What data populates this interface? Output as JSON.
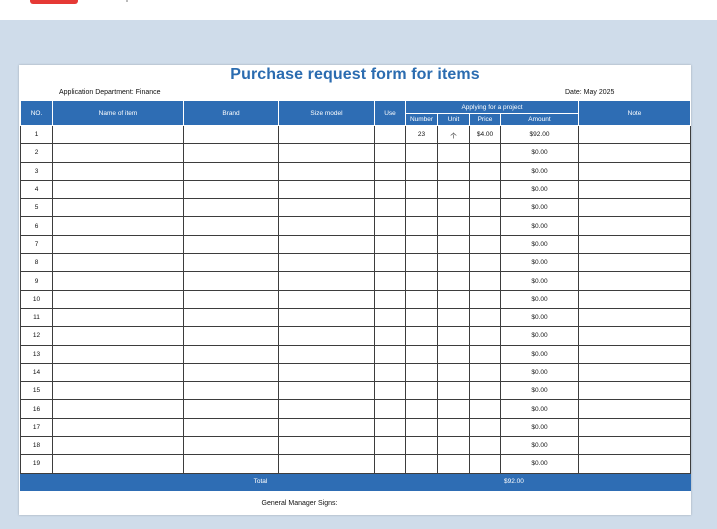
{
  "document": {
    "title": "Purchase request form for items",
    "department": "Application Department: Finance",
    "date": "Date: May 2025",
    "signature_label": "General Manager Signs:"
  },
  "table": {
    "headers": {
      "no": "NO.",
      "name": "Name of item",
      "brand": "Brand",
      "size": "Size model",
      "use": "Use",
      "group": "Applying for a project",
      "number": "Number",
      "unit": "Unit",
      "price": "Price",
      "amount": "Amount",
      "note": "Note"
    },
    "rows": [
      {
        "no": "1",
        "name": "",
        "brand": "",
        "size": "",
        "use": "",
        "number": "23",
        "unit": "个",
        "price": "$4.00",
        "amount": "$92.00",
        "note": ""
      },
      {
        "no": "2",
        "name": "",
        "brand": "",
        "size": "",
        "use": "",
        "number": "",
        "unit": "",
        "price": "",
        "amount": "$0.00",
        "note": ""
      },
      {
        "no": "3",
        "name": "",
        "brand": "",
        "size": "",
        "use": "",
        "number": "",
        "unit": "",
        "price": "",
        "amount": "$0.00",
        "note": ""
      },
      {
        "no": "4",
        "name": "",
        "brand": "",
        "size": "",
        "use": "",
        "number": "",
        "unit": "",
        "price": "",
        "amount": "$0.00",
        "note": ""
      },
      {
        "no": "5",
        "name": "",
        "brand": "",
        "size": "",
        "use": "",
        "number": "",
        "unit": "",
        "price": "",
        "amount": "$0.00",
        "note": ""
      },
      {
        "no": "6",
        "name": "",
        "brand": "",
        "size": "",
        "use": "",
        "number": "",
        "unit": "",
        "price": "",
        "amount": "$0.00",
        "note": ""
      },
      {
        "no": "7",
        "name": "",
        "brand": "",
        "size": "",
        "use": "",
        "number": "",
        "unit": "",
        "price": "",
        "amount": "$0.00",
        "note": ""
      },
      {
        "no": "8",
        "name": "",
        "brand": "",
        "size": "",
        "use": "",
        "number": "",
        "unit": "",
        "price": "",
        "amount": "$0.00",
        "note": ""
      },
      {
        "no": "9",
        "name": "",
        "brand": "",
        "size": "",
        "use": "",
        "number": "",
        "unit": "",
        "price": "",
        "amount": "$0.00",
        "note": ""
      },
      {
        "no": "10",
        "name": "",
        "brand": "",
        "size": "",
        "use": "",
        "number": "",
        "unit": "",
        "price": "",
        "amount": "$0.00",
        "note": ""
      },
      {
        "no": "11",
        "name": "",
        "brand": "",
        "size": "",
        "use": "",
        "number": "",
        "unit": "",
        "price": "",
        "amount": "$0.00",
        "note": ""
      },
      {
        "no": "12",
        "name": "",
        "brand": "",
        "size": "",
        "use": "",
        "number": "",
        "unit": "",
        "price": "",
        "amount": "$0.00",
        "note": ""
      },
      {
        "no": "13",
        "name": "",
        "brand": "",
        "size": "",
        "use": "",
        "number": "",
        "unit": "",
        "price": "",
        "amount": "$0.00",
        "note": ""
      },
      {
        "no": "14",
        "name": "",
        "brand": "",
        "size": "",
        "use": "",
        "number": "",
        "unit": "",
        "price": "",
        "amount": "$0.00",
        "note": ""
      },
      {
        "no": "15",
        "name": "",
        "brand": "",
        "size": "",
        "use": "",
        "number": "",
        "unit": "",
        "price": "",
        "amount": "$0.00",
        "note": ""
      },
      {
        "no": "16",
        "name": "",
        "brand": "",
        "size": "",
        "use": "",
        "number": "",
        "unit": "",
        "price": "",
        "amount": "$0.00",
        "note": ""
      },
      {
        "no": "17",
        "name": "",
        "brand": "",
        "size": "",
        "use": "",
        "number": "",
        "unit": "",
        "price": "",
        "amount": "$0.00",
        "note": ""
      },
      {
        "no": "18",
        "name": "",
        "brand": "",
        "size": "",
        "use": "",
        "number": "",
        "unit": "",
        "price": "",
        "amount": "$0.00",
        "note": ""
      },
      {
        "no": "19",
        "name": "",
        "brand": "",
        "size": "",
        "use": "",
        "number": "",
        "unit": "",
        "price": "",
        "amount": "$0.00",
        "note": ""
      }
    ],
    "footer": {
      "total_label": "Total",
      "total_amount": "$92.00"
    }
  }
}
